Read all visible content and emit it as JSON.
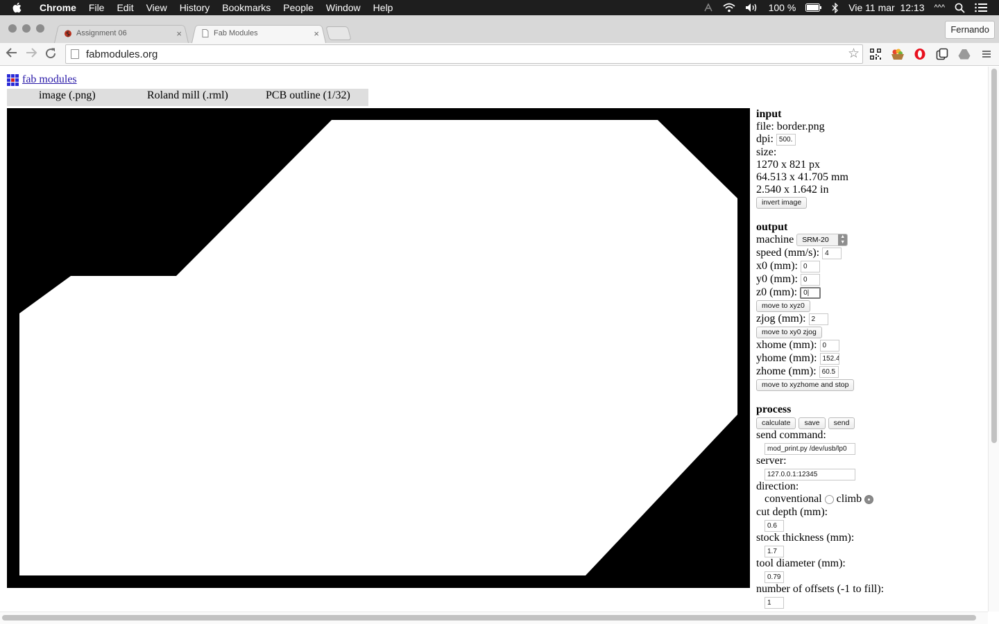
{
  "menubar": {
    "app": "Chrome",
    "items": [
      "File",
      "Edit",
      "View",
      "History",
      "Bookmarks",
      "People",
      "Window",
      "Help"
    ],
    "battery": "100 %",
    "datetime": "Vie 11 mar  12:13",
    "extra": "^^^"
  },
  "tabs": [
    {
      "title": "Assignment 06",
      "active": false
    },
    {
      "title": "Fab Modules",
      "active": true
    }
  ],
  "profile": "Fernando",
  "address": "fabmodules.org",
  "page": {
    "logo_text": "fab modules",
    "modules": [
      "image (.png)",
      "Roland mill (.rml)",
      "PCB outline (1/32)"
    ],
    "input": {
      "heading": "input",
      "file": "file: border.png",
      "dpi_label": "dpi:",
      "dpi": "500.",
      "size_label": "size:",
      "size_px": "1270 x 821 px",
      "size_mm": "64.513 x 41.705 mm",
      "size_in": "2.540 x 1.642 in",
      "invert_btn": "invert image"
    },
    "output": {
      "heading": "output",
      "machine_label": "machine",
      "machine": "SRM-20",
      "speed_label": "speed (mm/s):",
      "speed": "4",
      "x0_label": "x0 (mm):",
      "x0": "0",
      "y0_label": "y0 (mm):",
      "y0": "0",
      "z0_label": "z0 (mm):",
      "z0": "0|",
      "move_xyz0_btn": "move to xyz0",
      "zjog_label": "zjog (mm):",
      "zjog": "2",
      "move_xy0_btn": "move to xy0 zjog",
      "xhome_label": "xhome (mm):",
      "xhome": "0",
      "yhome_label": "yhome (mm):",
      "yhome": "152.4",
      "zhome_label": "zhome (mm):",
      "zhome": "60.5",
      "move_home_btn": "move to xyzhome and stop"
    },
    "process": {
      "heading": "process",
      "calculate_btn": "calculate",
      "save_btn": "save",
      "send_btn": "send",
      "send_cmd_label": "send command:",
      "send_cmd": "mod_print.py /dev/usb/lp0",
      "server_label": "server:",
      "server": "127.0.0.1:12345",
      "direction_label": "direction:",
      "conventional": "conventional",
      "climb": "climb",
      "direction_selected": "climb",
      "cut_depth_label": "cut depth (mm):",
      "cut_depth": "0.6",
      "stock_label": "stock thickness (mm):",
      "stock": "1.7",
      "tool_label": "tool diameter (mm):",
      "tool": "0.79",
      "offsets_label": "number of offsets (-1 to fill):",
      "offsets": "1"
    }
  }
}
